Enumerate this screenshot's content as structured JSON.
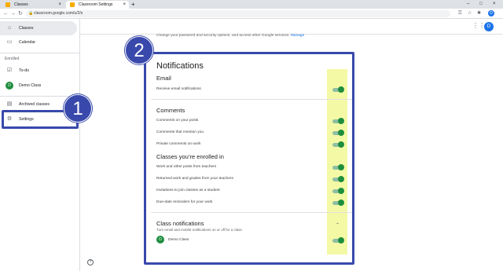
{
  "browser": {
    "tabs": [
      {
        "title": "Classes"
      },
      {
        "title": "Classroom Settings"
      }
    ],
    "new_tab": "+",
    "close": "×",
    "url": "classroom.google.com/u/2/s",
    "profile_initial": "D",
    "window_controls": [
      "–",
      "□",
      "×"
    ]
  },
  "sidebar": {
    "items": [
      {
        "label": "Classes",
        "icon": "home-icon"
      },
      {
        "label": "Calendar",
        "icon": "calendar-icon"
      }
    ],
    "enrolled_label": "Enrolled",
    "enrolled": [
      {
        "label": "To-do",
        "icon": "todo-icon"
      },
      {
        "label": "Demo Class",
        "initial": "D"
      }
    ],
    "archived": {
      "label": "Archived classes",
      "icon": "archive-icon"
    },
    "settings": {
      "label": "Settings",
      "icon": "gear-icon"
    }
  },
  "header": {
    "user_initial": "D"
  },
  "account": {
    "text": "Change your password and security options, and access other Google services.",
    "link": "Manage"
  },
  "notifications": {
    "title": "Notifications",
    "email": {
      "heading": "Email",
      "rows": [
        {
          "label": "Receive email notifications",
          "on": true
        }
      ]
    },
    "comments": {
      "heading": "Comments",
      "rows": [
        {
          "label": "Comments on your posts",
          "on": true
        },
        {
          "label": "Comments that mention you",
          "on": true
        },
        {
          "label": "Private comments on work",
          "on": true
        }
      ]
    },
    "classes": {
      "heading": "Classes you’re enrolled in",
      "rows": [
        {
          "label": "Work and other posts from teachers",
          "on": true
        },
        {
          "label": "Returned work and grades from your teachers",
          "on": true
        },
        {
          "label": "Invitations to join classes as a student",
          "on": true
        },
        {
          "label": "Due-date reminders for your work",
          "on": true
        }
      ]
    },
    "class_notifications": {
      "heading": "Class notifications",
      "subtitle": "Turn email and mobile notifications on or off for a class",
      "rows": [
        {
          "label": "Demo Class",
          "initial": "D",
          "on": true
        }
      ]
    }
  },
  "callouts": {
    "one": "1",
    "two": "2"
  },
  "colors": {
    "callout": "#3949ab",
    "toggle_on": "#1e8e3e",
    "highlight": "#f4f9a5"
  }
}
